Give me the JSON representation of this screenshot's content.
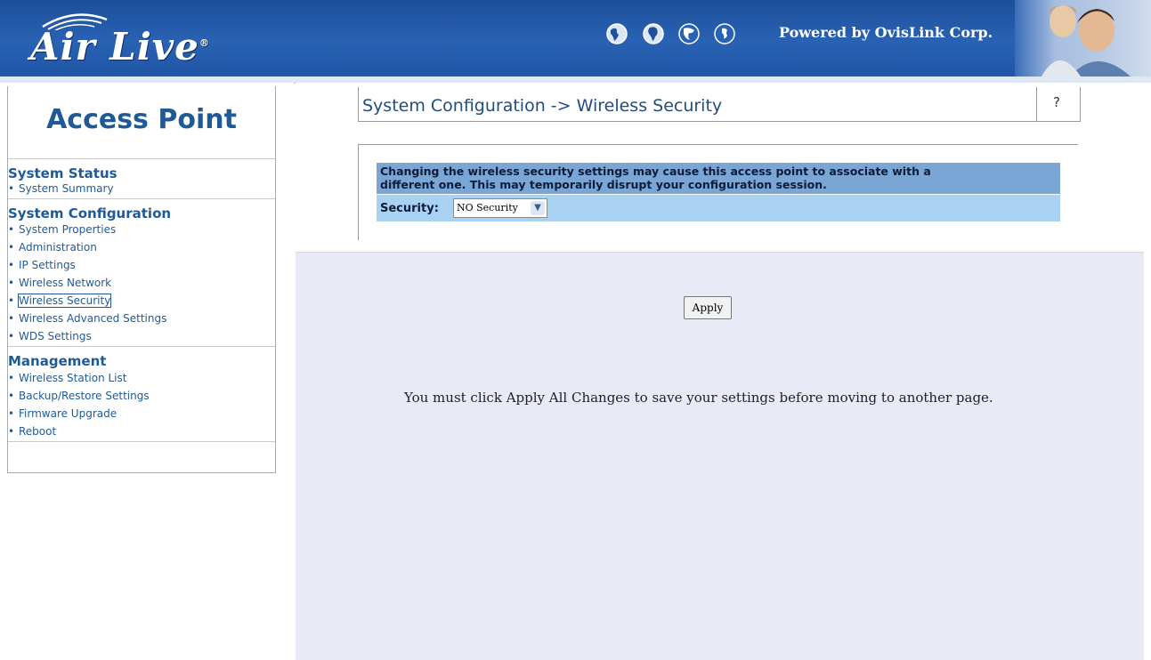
{
  "header": {
    "logo_text": "Air Live",
    "logo_reg": "®",
    "powered_by": "Powered by OvisLink Corp.",
    "globe_icons": [
      "globe-americas-icon",
      "globe-africa-icon",
      "globe-europe-icon",
      "globe-asia-icon"
    ]
  },
  "sidebar": {
    "title": "Access Point",
    "sections": [
      {
        "heading": "System Status",
        "items": [
          "System Summary"
        ]
      },
      {
        "heading": "System Configuration",
        "items": [
          "System Properties",
          "Administration",
          "IP Settings",
          "Wireless Network",
          "Wireless Security",
          "Wireless Advanced Settings",
          "WDS Settings"
        ]
      },
      {
        "heading": "Management",
        "items": [
          "Wireless Station List",
          "Backup/Restore Settings",
          "Firmware Upgrade",
          "Reboot"
        ]
      }
    ],
    "active_item": "Wireless Security"
  },
  "main": {
    "page_title": "System Configuration -> Wireless Security",
    "help_label": "?",
    "warning_line1": "Changing the wireless security settings may cause this access point to associate with a",
    "warning_line2": "different one. This may temporarily disrupt your configuration session.",
    "security_label": "Security:",
    "security_value": "NO Security",
    "apply_label": "Apply",
    "apply_note": "You must click Apply All Changes to save your settings before moving to another page."
  },
  "colors": {
    "header_blue": "#2a62b3",
    "nav_text": "#1f5a96",
    "warning_bg": "#7aa6d6",
    "security_row_bg": "#a9d1f2",
    "content_bg": "#e8eaf6"
  }
}
